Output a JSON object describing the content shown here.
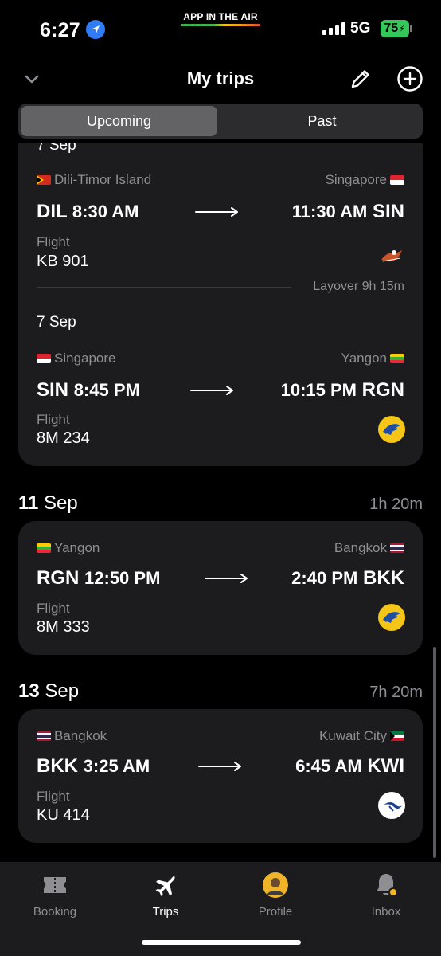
{
  "status_bar": {
    "time": "6:27",
    "app_banner": "APP IN THE AIR",
    "network": "5G",
    "battery": "75"
  },
  "header": {
    "title": "My trips"
  },
  "segments": {
    "upcoming": "Upcoming",
    "past": "Past"
  },
  "trip1": {
    "partial_date": "7 Sep",
    "leg1": {
      "from_city": "Dili-Timor Island",
      "to_city": "Singapore",
      "from_code": "DIL",
      "dep_time": "8:30 AM",
      "arr_time": "11:30 AM",
      "to_code": "SIN",
      "flight_label": "Flight",
      "flight_number": "KB 901"
    },
    "layover": "Layover 9h 15m",
    "leg2": {
      "date": "7 Sep",
      "from_city": "Singapore",
      "to_city": "Yangon",
      "from_code": "SIN",
      "dep_time": "8:45 PM",
      "arr_time": "10:15 PM",
      "to_code": "RGN",
      "flight_label": "Flight",
      "flight_number": "8M 234"
    }
  },
  "trip2": {
    "day": "11",
    "month": "Sep",
    "duration": "1h 20m",
    "from_city": "Yangon",
    "to_city": "Bangkok",
    "from_code": "RGN",
    "dep_time": "12:50 PM",
    "arr_time": "2:40 PM",
    "to_code": "BKK",
    "flight_label": "Flight",
    "flight_number": "8M 333"
  },
  "trip3": {
    "day": "13",
    "month": "Sep",
    "duration": "7h 20m",
    "from_city": "Bangkok",
    "to_city": "Kuwait City",
    "from_code": "BKK",
    "dep_time": "3:25 AM",
    "arr_time": "6:45 AM",
    "to_code": "KWI",
    "flight_label": "Flight",
    "flight_number": "KU 414"
  },
  "tabbar": {
    "booking": "Booking",
    "trips": "Trips",
    "profile": "Profile",
    "inbox": "Inbox"
  },
  "icons": [
    "location-arrow-icon",
    "chevron-down-icon",
    "pencil-icon",
    "plus-circle-icon",
    "arrow-right-icon",
    "booking-ticket-icon",
    "airplane-icon",
    "avatar",
    "bell-icon"
  ],
  "colors": {
    "accent_green": "#34c759",
    "card_bg": "#1c1c1e",
    "muted": "#8e8e93"
  }
}
